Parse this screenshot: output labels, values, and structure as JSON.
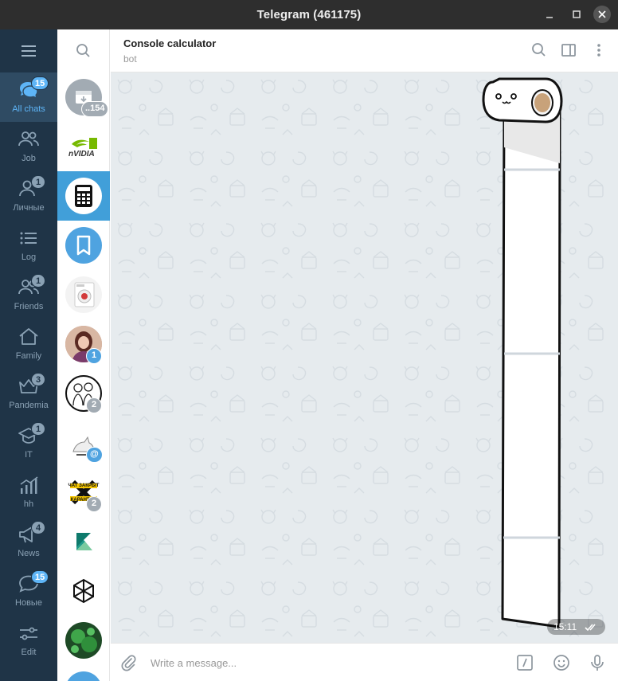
{
  "window": {
    "title": "Telegram (461175)"
  },
  "folders": [
    {
      "label": "All chats",
      "badge": "15",
      "active": true
    },
    {
      "label": "Job",
      "badge": ""
    },
    {
      "label": "Личные",
      "badge": "1"
    },
    {
      "label": "Log",
      "badge": ""
    },
    {
      "label": "Friends",
      "badge": "1"
    },
    {
      "label": "Family",
      "badge": ""
    },
    {
      "label": "Pandemia",
      "badge": "3"
    },
    {
      "label": "IT",
      "badge": "1"
    },
    {
      "label": "hh",
      "badge": ""
    },
    {
      "label": "News",
      "badge": "4"
    },
    {
      "label": "Новые",
      "badge": "15"
    },
    {
      "label": "Edit",
      "badge": ""
    }
  ],
  "chats": [
    {
      "badge": "..154",
      "icon": "archive-icon"
    },
    {
      "badge": "",
      "icon": "nvidia-logo",
      "logo_text": "nVIDIA"
    },
    {
      "badge": "",
      "icon": "calculator-icon",
      "active": true
    },
    {
      "badge": "",
      "icon": "bookmark-icon"
    },
    {
      "badge": "",
      "icon": "washing-machine-avatar"
    },
    {
      "badge": "1",
      "icon": "person-avatar"
    },
    {
      "badge": "2",
      "icon": "drawing-avatar"
    },
    {
      "badge": "@",
      "icon": "cat-avatar"
    },
    {
      "badge": "2",
      "icon": "chat-closed-avatar",
      "logo_text": "ЧАТ ЗАКРЫТ НА КАРАНТИН"
    },
    {
      "badge": "",
      "icon": "kotlin-logo"
    },
    {
      "badge": "",
      "icon": "hexagon-logo"
    },
    {
      "badge": "",
      "icon": "virus-avatar"
    }
  ],
  "header": {
    "name": "Console calculator",
    "status": "bot"
  },
  "message": {
    "time": "15:11",
    "content": "sticker-toilet-paper"
  },
  "composer": {
    "placeholder": "Write a message..."
  },
  "colors": {
    "sidebar": "#1f3447",
    "accent": "#5eb5f7",
    "active_chat": "#419fd9",
    "chat_bg": "#e6ebee"
  }
}
